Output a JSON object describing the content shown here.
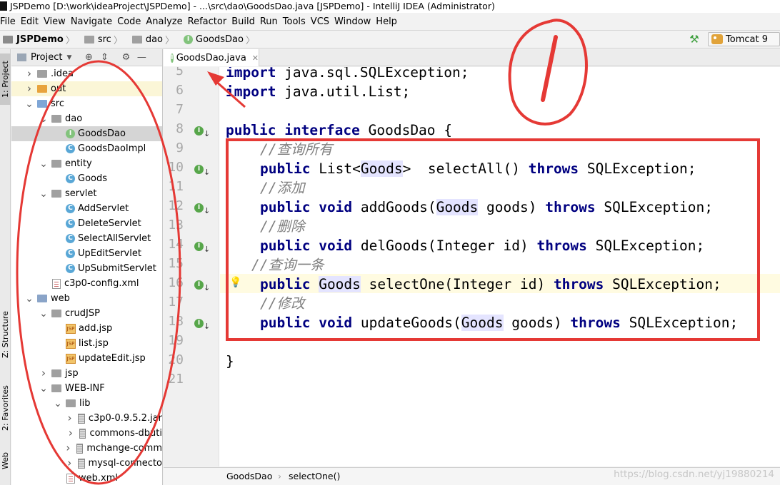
{
  "window": {
    "title": "JSPDemo [D:\\work\\ideaProject\\JSPDemo] - ...\\src\\dao\\GoodsDao.java [JSPDemo] - IntelliJ IDEA (Administrator)"
  },
  "menu": [
    "File",
    "Edit",
    "View",
    "Navigate",
    "Code",
    "Analyze",
    "Refactor",
    "Build",
    "Run",
    "Tools",
    "VCS",
    "Window",
    "Help"
  ],
  "breadcrumbs": {
    "project": "JSPDemo",
    "src": "src",
    "dao": "dao",
    "file": "GoodsDao"
  },
  "run_config": "Tomcat 9",
  "left_strip": {
    "project": "1: Project",
    "structure": "Z: Structure",
    "favorites": "2: Favorites",
    "web": "Web"
  },
  "project_panel": {
    "title": "Project",
    "tree": [
      {
        "label": ".idea",
        "icon": "folder-icon",
        "depth": 1,
        "arrow": "collapsed"
      },
      {
        "label": "out",
        "icon": "folder-orange-icon",
        "depth": 1,
        "arrow": "collapsed",
        "highlight": true
      },
      {
        "label": "src",
        "icon": "source-folder-icon",
        "depth": 1,
        "arrow": "expanded"
      },
      {
        "label": "dao",
        "icon": "package-icon",
        "depth": 2,
        "arrow": "expanded"
      },
      {
        "label": "GoodsDao",
        "icon": "interface-icon",
        "depth": 3,
        "arrow": "none",
        "selected": true
      },
      {
        "label": "GoodsDaoImpl",
        "icon": "class-icon",
        "depth": 3,
        "arrow": "none"
      },
      {
        "label": "entity",
        "icon": "package-icon",
        "depth": 2,
        "arrow": "expanded"
      },
      {
        "label": "Goods",
        "icon": "class-icon",
        "depth": 3,
        "arrow": "none"
      },
      {
        "label": "servlet",
        "icon": "package-icon",
        "depth": 2,
        "arrow": "expanded"
      },
      {
        "label": "AddServlet",
        "icon": "class-icon",
        "depth": 3,
        "arrow": "none"
      },
      {
        "label": "DeleteServlet",
        "icon": "class-icon",
        "depth": 3,
        "arrow": "none"
      },
      {
        "label": "SelectAllServlet",
        "icon": "class-icon",
        "depth": 3,
        "arrow": "none"
      },
      {
        "label": "UpEditServlet",
        "icon": "class-icon",
        "depth": 3,
        "arrow": "none"
      },
      {
        "label": "UpSubmitServlet",
        "icon": "class-icon",
        "depth": 3,
        "arrow": "none"
      },
      {
        "label": "c3p0-config.xml",
        "icon": "xml-file-icon",
        "depth": 2,
        "arrow": "none"
      },
      {
        "label": "web",
        "icon": "web-folder-icon",
        "depth": 1,
        "arrow": "expanded"
      },
      {
        "label": "crudJSP",
        "icon": "folder-icon",
        "depth": 2,
        "arrow": "expanded"
      },
      {
        "label": "add.jsp",
        "icon": "jsp-file-icon",
        "depth": 3,
        "arrow": "none"
      },
      {
        "label": "list.jsp",
        "icon": "jsp-file-icon",
        "depth": 3,
        "arrow": "none"
      },
      {
        "label": "updateEdit.jsp",
        "icon": "jsp-file-icon",
        "depth": 3,
        "arrow": "none"
      },
      {
        "label": "jsp",
        "icon": "folder-icon",
        "depth": 2,
        "arrow": "collapsed"
      },
      {
        "label": "WEB-INF",
        "icon": "folder-icon",
        "depth": 2,
        "arrow": "expanded"
      },
      {
        "label": "lib",
        "icon": "folder-icon",
        "depth": 3,
        "arrow": "expanded"
      },
      {
        "label": "c3p0-0.9.5.2.jar",
        "icon": "jar-icon",
        "depth": 4,
        "arrow": "collapsed"
      },
      {
        "label": "commons-dbuti",
        "icon": "jar-icon",
        "depth": 4,
        "arrow": "collapsed"
      },
      {
        "label": "mchange-comm",
        "icon": "jar-icon",
        "depth": 4,
        "arrow": "collapsed"
      },
      {
        "label": "mysql-connecto",
        "icon": "jar-icon",
        "depth": 4,
        "arrow": "collapsed"
      },
      {
        "label": "web.xml",
        "icon": "xml-file-icon",
        "depth": 3,
        "arrow": "none"
      }
    ]
  },
  "editor": {
    "tab_label": "GoodsDao.java",
    "line_numbers": [
      "5",
      "6",
      "7",
      "8",
      "9",
      "10",
      "11",
      "12",
      "13",
      "14",
      "15",
      "16",
      "17",
      "18",
      "19",
      "20",
      "21"
    ],
    "lines": {
      "l5": {
        "kw": "import",
        "rest": " java.sql.SQLException;"
      },
      "l6": {
        "kw": "import",
        "rest": " java.util.List;"
      },
      "l8": {
        "kw1": "public",
        "kw2": "interface",
        "rest": " GoodsDao {"
      },
      "l9": {
        "comment": "//查询所有"
      },
      "l10": {
        "kw": "public",
        "a": " List<",
        "type": "Goods",
        "b": ">  selectAll() ",
        "kw2": "throws",
        "c": " SQLException;"
      },
      "l11": {
        "comment": "//添加"
      },
      "l12": {
        "kw": "public",
        "kw2": "void",
        "a": " addGoods(",
        "type": "Goods",
        "b": " goods) ",
        "kw3": "throws",
        "c": " SQLException;"
      },
      "l13": {
        "comment": "//删除"
      },
      "l14": {
        "kw": "public",
        "kw2": "void",
        "a": " delGoods(Integer id) ",
        "kw3": "throws",
        "c": " SQLException;"
      },
      "l15": {
        "comment": "//查询一条"
      },
      "l16": {
        "kw": "public",
        "type": "Goods",
        "a": " selectOne(Integer id) ",
        "kw2": "throws",
        "c": " SQLException;"
      },
      "l17": {
        "comment": "//修改"
      },
      "l18": {
        "kw": "public",
        "kw2": "void",
        "a": " updateGoods(",
        "type": "Goods",
        "b": " goods) ",
        "kw3": "throws",
        "c": " SQLException;"
      },
      "l20": {
        "text": "}"
      }
    }
  },
  "status": {
    "crumb1": "GoodsDao",
    "crumb2": "selectOne()",
    "watermark": "https://blog.csdn.net/yj19880214"
  },
  "colors": {
    "annotation": "#e53935",
    "keyword": "#000080",
    "comment": "#808080"
  }
}
